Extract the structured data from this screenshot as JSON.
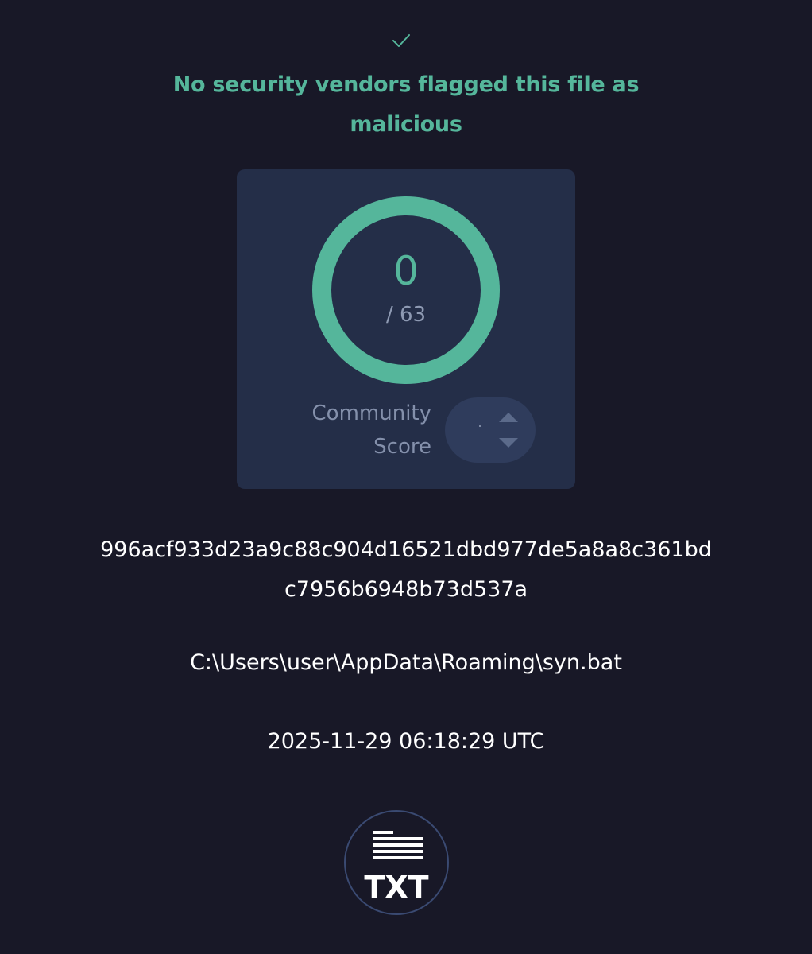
{
  "verdict": {
    "icon": "check-icon",
    "text": "No security vendors flagged this file as malicious",
    "color": "#55b69b"
  },
  "score_card": {
    "detections": "0",
    "total": "/ 63",
    "detection_ratio": 0.0,
    "ring_color": "#55b69b",
    "community_label": "Community Score",
    "community_value": "·"
  },
  "file": {
    "hash": "996acf933d23a9c88c904d16521dbd977de5a8a8c361bdc7956b6948b73d537a",
    "path": "C:\\Users\\user\\AppData\\Roaming\\syn.bat",
    "date": "2025-11-29 06:18:29 UTC"
  },
  "export": {
    "icon": "txt-file-icon",
    "label": "TXT"
  }
}
